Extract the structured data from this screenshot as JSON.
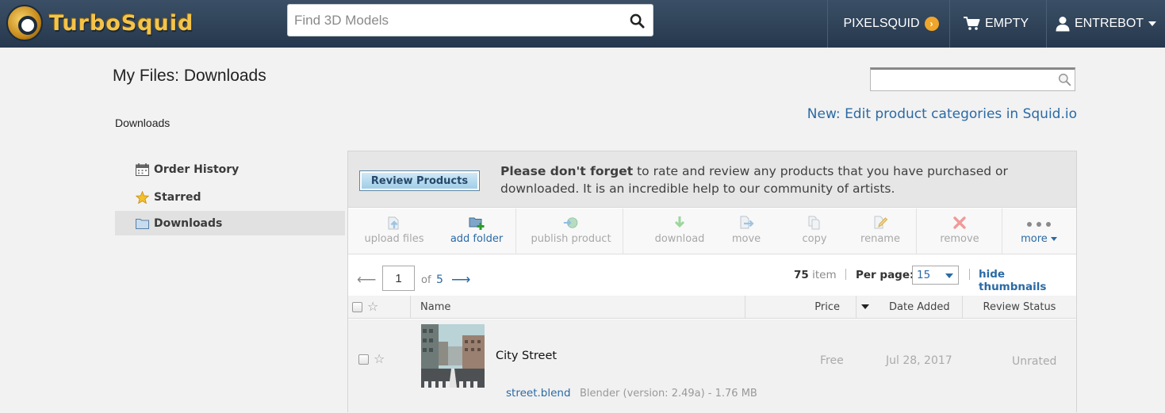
{
  "header": {
    "brand": "TurboSquid",
    "search_placeholder": "Find 3D Models",
    "nav": {
      "pixelsquid": "PIXELSQUID",
      "cart": "EMPTY",
      "user": "ENTREBOT"
    }
  },
  "page": {
    "title": "My Files:  Downloads",
    "breadcrumb": "Downloads",
    "announcement": "New: Edit product categories in Squid.io"
  },
  "sidebar": {
    "items": [
      {
        "label": "Order History",
        "icon": "calendar-icon"
      },
      {
        "label": "Starred",
        "icon": "star-icon"
      },
      {
        "label": "Downloads",
        "icon": "folder-icon",
        "selected": true
      }
    ]
  },
  "notice": {
    "button": "Review Products",
    "bold": "Please don't forget",
    "text": " to rate and review any products that you have purchased or downloaded. It is an incredible help to our community of artists."
  },
  "toolbar": {
    "upload": "upload files",
    "add_folder": "add folder",
    "publish": "publish product",
    "download": "download",
    "move": "move",
    "copy": "copy",
    "rename": "rename",
    "remove": "remove",
    "more": "more"
  },
  "pager": {
    "current_page": "1",
    "of_label": "of",
    "total_pages": "5",
    "item_count": "75",
    "item_label": "item",
    "per_page_label": "Per page:",
    "per_page_value": "15",
    "hide_thumbnails": "hide thumbnails"
  },
  "table": {
    "columns": {
      "name": "Name",
      "price": "Price",
      "date": "Date Added",
      "status": "Review Status"
    },
    "rows": [
      {
        "name": "City Street",
        "price": "Free",
        "date": "Jul 28, 2017",
        "status": "Unrated",
        "file": "street.blend",
        "meta": "Blender  (version: 2.49a) - 1.76 MB"
      }
    ]
  },
  "colors": {
    "header_bg": "#2f4259",
    "link_blue": "#2a6aa5",
    "brand_gold": "#f4c44a",
    "pixelsquid_orange": "#f0a52b"
  }
}
